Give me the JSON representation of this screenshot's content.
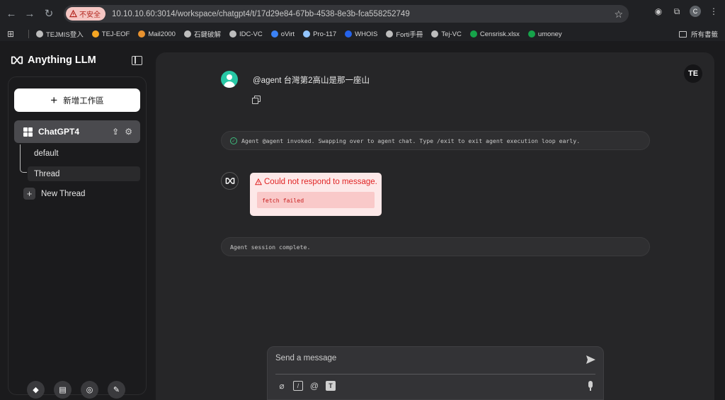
{
  "browser": {
    "security_label": "不安全",
    "url": "10.10.10.60:3014/workspace/chatgpt4/t/17d29e84-67bb-4538-8e3b-fca558252749",
    "profile_initial": "C",
    "bookmarks": [
      {
        "label": "TEJMIS登入",
        "icon": "globe-icon",
        "color": "#bdbdbd"
      },
      {
        "label": "TEJ-EOF",
        "icon": "u-logo-icon",
        "color": "#f5a623"
      },
      {
        "label": "Mail2000",
        "icon": "mail-icon",
        "color": "#e8922f"
      },
      {
        "label": "石鍵破解",
        "icon": "globe-icon",
        "color": "#bdbdbd"
      },
      {
        "label": "IDC-VC",
        "icon": "globe-icon",
        "color": "#bdbdbd"
      },
      {
        "label": "oVirt",
        "icon": "ovirt-icon",
        "color": "#3b82f6"
      },
      {
        "label": "Pro-117",
        "icon": "page-icon",
        "color": "#93c5fd"
      },
      {
        "label": "WHOIS",
        "icon": "word-icon",
        "color": "#2563eb"
      },
      {
        "label": "Forti手冊",
        "icon": "globe-icon",
        "color": "#bdbdbd"
      },
      {
        "label": "Tej-VC",
        "icon": "globe-icon",
        "color": "#bdbdbd"
      },
      {
        "label": "Censrisk.xlsx",
        "icon": "excel-icon",
        "color": "#16a34a"
      },
      {
        "label": "umoney",
        "icon": "excel-icon",
        "color": "#16a34a"
      }
    ],
    "all_bookmarks_label": "所有書籤"
  },
  "sidebar": {
    "brand": "Anything LLM",
    "new_workspace_label": "新增工作區",
    "workspace_name": "ChatGPT4",
    "threads": [
      "default",
      "Thread"
    ],
    "active_thread": "Thread",
    "new_thread_label": "New Thread"
  },
  "chat": {
    "user_badge": "TE",
    "user_message": "@agent 台灣第2高山是那一座山",
    "invoke_status": "Agent @agent invoked. Swapping over to agent chat. Type /exit to exit agent execution loop early.",
    "error_title": "Could not respond to message.",
    "error_detail": "fetch failed",
    "complete_status": "Agent session complete."
  },
  "composer": {
    "placeholder": "Send a message"
  },
  "colors": {
    "accent_teal": "#27c7a5",
    "error_red": "#e02424",
    "success_green": "#3fbf7f"
  }
}
